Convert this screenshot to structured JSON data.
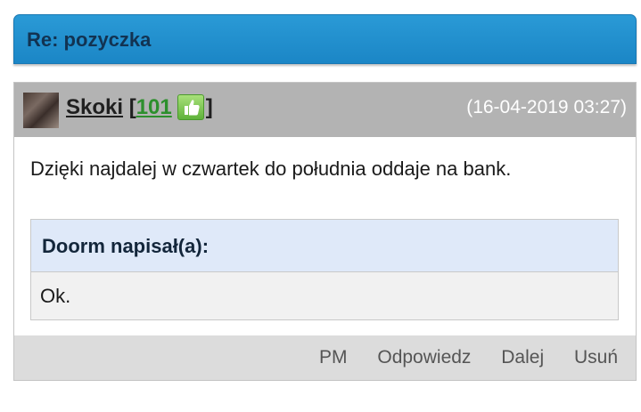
{
  "topic": {
    "title": "Re: pozyczka"
  },
  "post": {
    "author": "Skoki",
    "reputation": "101",
    "bracket_open": "[",
    "bracket_close": "]",
    "date": "(16-04-2019 03:27)",
    "message": "Dzięki najdalej w czwartek do południa oddaje na bank.",
    "quote": {
      "author": "Doorm napisał(a):",
      "text": "Ok."
    },
    "actions": {
      "pm": "PM",
      "reply": "Odpowiedz",
      "forward": "Dalej",
      "delete": "Usuń"
    }
  },
  "colors": {
    "header_blue": "#1b86c6",
    "reputation_green": "#2d8f2d",
    "quote_header_bg": "#dfe9f9"
  },
  "icons": {
    "reputation": "thumbs-up-icon"
  }
}
